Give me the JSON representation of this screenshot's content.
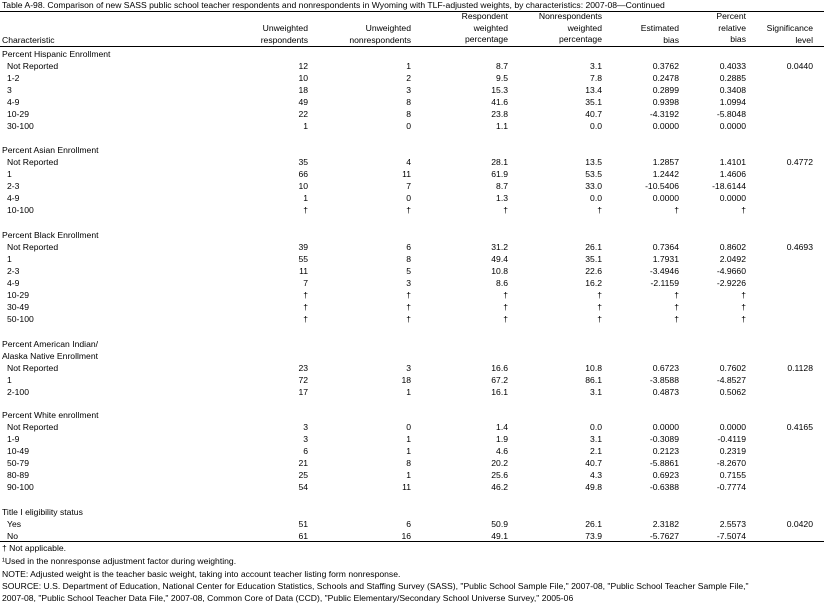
{
  "title": "Table A-98. Comparison of new SASS public school teacher respondents and nonrespondents in Wyoming with TLF-adjusted weights, by characteristics: 2007-08—Continued",
  "columns": {
    "characteristic": "Characteristic",
    "unweighted_respondents": "Unweighted\nrespondents",
    "unweighted_nonrespondents": "Unweighted\nnonrespondents",
    "respondent_weighted_pct": "Respondent\nweighted\npercentage",
    "nonrespondents_weighted_pct": "Nonrespondents\nweighted\npercentage",
    "estimated_bias": "Estimated\nbias",
    "percent_relative_bias": "Percent\nrelative\nbias",
    "significance_level": "Significance\nlevel"
  },
  "rows": [
    {
      "label": "Percent Hispanic Enrollment",
      "type": "section"
    },
    {
      "label": "Not Reported",
      "type": "data",
      "values": [
        "12",
        "1",
        "8.7",
        "3.1",
        "0.3762",
        "0.4033",
        "0.0440"
      ]
    },
    {
      "label": "1-2",
      "type": "data",
      "values": [
        "10",
        "2",
        "9.5",
        "7.8",
        "0.2478",
        "0.2885",
        ""
      ]
    },
    {
      "label": "3",
      "type": "data",
      "values": [
        "18",
        "3",
        "15.3",
        "13.4",
        "0.2899",
        "0.3408",
        ""
      ]
    },
    {
      "label": "4-9",
      "type": "data",
      "values": [
        "49",
        "8",
        "41.6",
        "35.1",
        "0.9398",
        "1.0994",
        ""
      ]
    },
    {
      "label": "10-29",
      "type": "data",
      "values": [
        "22",
        "8",
        "23.8",
        "40.7",
        "-4.3192",
        "-5.8048",
        ""
      ]
    },
    {
      "label": "30-100",
      "type": "data",
      "values": [
        "1",
        "0",
        "1.1",
        "0.0",
        "0.0000",
        "0.0000",
        ""
      ]
    },
    {
      "label": "Percent Asian Enrollment",
      "type": "section"
    },
    {
      "label": "Not Reported",
      "type": "data",
      "values": [
        "35",
        "4",
        "28.1",
        "13.5",
        "1.2857",
        "1.4101",
        "0.4772"
      ]
    },
    {
      "label": "1",
      "type": "data",
      "values": [
        "66",
        "11",
        "61.9",
        "53.5",
        "1.2442",
        "1.4606",
        ""
      ]
    },
    {
      "label": "2-3",
      "type": "data",
      "values": [
        "10",
        "7",
        "8.7",
        "33.0",
        "-10.5406",
        "-18.6144",
        ""
      ]
    },
    {
      "label": "4-9",
      "type": "data",
      "values": [
        "1",
        "0",
        "1.3",
        "0.0",
        "0.0000",
        "0.0000",
        ""
      ]
    },
    {
      "label": "10-100",
      "type": "data",
      "values": [
        "†",
        "†",
        "†",
        "†",
        "†",
        "†",
        ""
      ]
    },
    {
      "label": "Percent Black Enrollment",
      "type": "section"
    },
    {
      "label": "Not Reported",
      "type": "data",
      "values": [
        "39",
        "6",
        "31.2",
        "26.1",
        "0.7364",
        "0.8602",
        "0.4693"
      ]
    },
    {
      "label": "1",
      "type": "data",
      "values": [
        "55",
        "8",
        "49.4",
        "35.1",
        "1.7931",
        "2.0492",
        ""
      ]
    },
    {
      "label": "2-3",
      "type": "data",
      "values": [
        "11",
        "5",
        "10.8",
        "22.6",
        "-3.4946",
        "-4.9660",
        ""
      ]
    },
    {
      "label": "4-9",
      "type": "data",
      "values": [
        "7",
        "3",
        "8.6",
        "16.2",
        "-2.1159",
        "-2.9226",
        ""
      ]
    },
    {
      "label": "10-29",
      "type": "data",
      "values": [
        "†",
        "†",
        "†",
        "†",
        "†",
        "†",
        ""
      ]
    },
    {
      "label": "30-49",
      "type": "data",
      "values": [
        "†",
        "†",
        "†",
        "†",
        "†",
        "†",
        ""
      ]
    },
    {
      "label": "50-100",
      "type": "data",
      "values": [
        "†",
        "†",
        "†",
        "†",
        "†",
        "†",
        ""
      ]
    },
    {
      "label": "Percent American Indian/",
      "type": "section"
    },
    {
      "label": "Alaska Native Enrollment",
      "type": "section"
    },
    {
      "label": "Not Reported",
      "type": "data",
      "values": [
        "23",
        "3",
        "16.6",
        "10.8",
        "0.6723",
        "0.7602",
        "0.1128"
      ]
    },
    {
      "label": "1",
      "type": "data",
      "values": [
        "72",
        "18",
        "67.2",
        "86.1",
        "-3.8588",
        "-4.8527",
        ""
      ]
    },
    {
      "label": "2-100",
      "type": "data",
      "values": [
        "17",
        "1",
        "16.1",
        "3.1",
        "0.4873",
        "0.5062",
        ""
      ]
    },
    {
      "label": "Percent White enrollment",
      "type": "section"
    },
    {
      "label": "Not Reported",
      "type": "data",
      "values": [
        "3",
        "0",
        "1.4",
        "0.0",
        "0.0000",
        "0.0000",
        "0.4165"
      ]
    },
    {
      "label": "1-9",
      "type": "data",
      "values": [
        "3",
        "1",
        "1.9",
        "3.1",
        "-0.3089",
        "-0.4119",
        ""
      ]
    },
    {
      "label": "10-49",
      "type": "data",
      "values": [
        "6",
        "1",
        "4.6",
        "2.1",
        "0.2123",
        "0.2319",
        ""
      ]
    },
    {
      "label": "50-79",
      "type": "data",
      "values": [
        "21",
        "8",
        "20.2",
        "40.7",
        "-5.8861",
        "-8.2670",
        ""
      ]
    },
    {
      "label": "80-89",
      "type": "data",
      "values": [
        "25",
        "1",
        "25.6",
        "4.3",
        "0.6923",
        "0.7155",
        ""
      ]
    },
    {
      "label": "90-100",
      "type": "data",
      "values": [
        "54",
        "11",
        "46.2",
        "49.8",
        "-0.6388",
        "-0.7774",
        ""
      ]
    },
    {
      "label": "Title I eligibility status",
      "type": "section"
    },
    {
      "label": "Yes",
      "type": "data",
      "values": [
        "51",
        "6",
        "50.9",
        "26.1",
        "2.3182",
        "2.5573",
        "0.0420"
      ]
    },
    {
      "label": "No",
      "type": "data",
      "values": [
        "61",
        "16",
        "49.1",
        "73.9",
        "-5.7627",
        "-7.5074",
        ""
      ]
    }
  ],
  "notes": [
    "† Not applicable.",
    "¹Used in the nonresponse adjustment factor during weighting.",
    "NOTE: Adjusted weight is the teacher basic weight, taking into account teacher listing form nonresponse.",
    "SOURCE: U.S. Department of Education, National Center for Education Statistics, Schools and Staffing Survey (SASS), \"Public School Sample File,\" 2007-08, \"Public School Teacher Sample File,\"",
    "2007-08, \"Public School Teacher Data File,\" 2007-08, Common Core of Data (CCD), \"Public Elementary/Secondary School Universe Survey,\" 2005-06"
  ]
}
